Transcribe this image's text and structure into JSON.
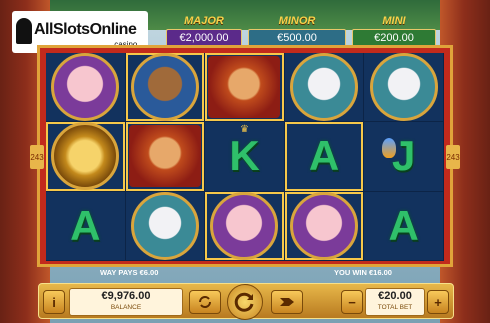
{
  "logo": {
    "name": "AllSlotsOnline",
    "sub": ".casino"
  },
  "jackpots": [
    {
      "label": "MAJOR",
      "value": "€2,000.00"
    },
    {
      "label": "MINOR",
      "value": "€500.00"
    },
    {
      "label": "MINI",
      "value": "€200.00"
    }
  ],
  "reels": {
    "symbols": [
      [
        "pig",
        "ram",
        "monkey",
        "rabbit",
        "rabbit"
      ],
      [
        "coin",
        "monkey",
        "K",
        "A",
        "J"
      ],
      [
        "A",
        "rabbit",
        "pig",
        "pig",
        "A"
      ]
    ]
  },
  "side_tags": {
    "left": "243",
    "right": "243"
  },
  "info": {
    "ways_pays": "WAY PAYS €6.00",
    "you_win": "YOU WIN €16.00"
  },
  "bar": {
    "info_icon": "i",
    "balance_value": "€9,976.00",
    "balance_label": "BALANCE",
    "bet_value": "€20.00",
    "bet_label": "TOTAL BET",
    "minus": "−",
    "plus": "+"
  }
}
